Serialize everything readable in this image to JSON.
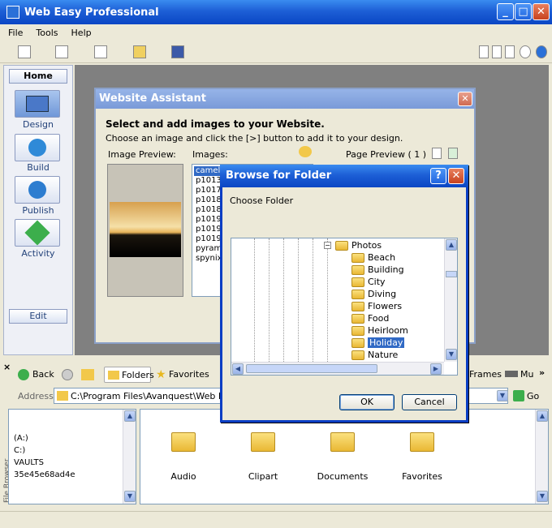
{
  "app": {
    "title": "Web Easy Professional",
    "menu": [
      "File",
      "Tools",
      "Help"
    ]
  },
  "sidebar": {
    "home_tab": "Home",
    "items": [
      {
        "label": "Design",
        "icon": "design-icon"
      },
      {
        "label": "Build",
        "icon": "build-icon"
      },
      {
        "label": "Publish",
        "icon": "publish-icon"
      },
      {
        "label": "Activity",
        "icon": "activity-icon"
      }
    ],
    "edit_tab": "Edit"
  },
  "assistant": {
    "title": "Website Assistant",
    "heading": "Select and add images to your Website.",
    "instructions": "Choose an image and click the [>] button to add it to your design.",
    "image_preview_label": "Image Preview:",
    "images_label": "Images:",
    "page_preview_label": "Page Preview  ( 1 )",
    "images": [
      "camels",
      "p1013",
      "p1017",
      "p1018",
      "p1018",
      "p1019",
      "p1019",
      "p1019",
      "pyramid",
      "spynix."
    ]
  },
  "dialog": {
    "title": "Browse for Folder",
    "prompt": "Choose Folder",
    "root": "Photos",
    "folders": [
      "Beach",
      "Building",
      "City",
      "Diving",
      "Flowers",
      "Food",
      "Heirloom",
      "Holiday",
      "Nature"
    ],
    "selected": "Holiday",
    "ok": "OK",
    "cancel": "Cancel"
  },
  "file_browser": {
    "back": "Back",
    "folders": "Folders",
    "favorites": "Favorites",
    "frames": "Frames",
    "mu": "Mu",
    "address_label": "Address",
    "address": "C:\\Program Files\\Avanquest\\Web Easy P",
    "go": "Go",
    "side_label": "File Browser",
    "tree": [
      "(A:)",
      "C:)",
      "VAULTS",
      "35e45e68ad4e"
    ],
    "icons": [
      {
        "label": "Audio"
      },
      {
        "label": "Clipart"
      },
      {
        "label": "Documents"
      },
      {
        "label": "Favorites"
      }
    ]
  }
}
